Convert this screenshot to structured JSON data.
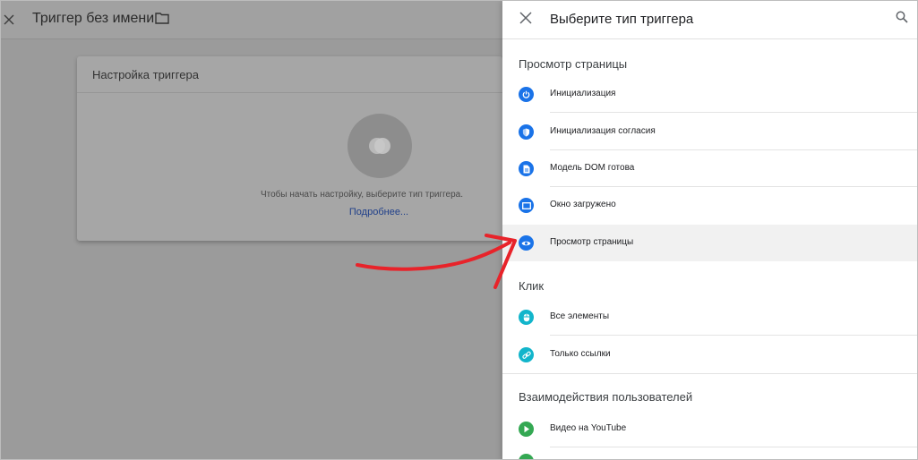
{
  "editor": {
    "title": "Триггер без имени",
    "card": {
      "header": "Настройка триггера",
      "hint": "Чтобы начать настройку, выберите тип триггера.",
      "link": "Подробнее..."
    }
  },
  "panel": {
    "title": "Выберите тип триггера",
    "sections": [
      {
        "title": "Просмотр страницы",
        "items": [
          {
            "label": "Инициализация",
            "icon": "power-icon",
            "color": "#1a73e8"
          },
          {
            "label": "Инициализация согласия",
            "icon": "shield-icon",
            "color": "#1a73e8"
          },
          {
            "label": "Модель DOM готова",
            "icon": "document-icon",
            "color": "#1a73e8"
          },
          {
            "label": "Окно загружено",
            "icon": "window-icon",
            "color": "#1a73e8"
          },
          {
            "label": "Просмотр страницы",
            "icon": "eye-icon",
            "color": "#1a73e8"
          }
        ]
      },
      {
        "title": "Клик",
        "items": [
          {
            "label": "Все элементы",
            "icon": "mouse-icon",
            "color": "#12b5cb"
          },
          {
            "label": "Только ссылки",
            "icon": "link-icon",
            "color": "#12b5cb"
          }
        ]
      },
      {
        "title": "Взаимодействия пользователей",
        "items": [
          {
            "label": "Видео на YouTube",
            "icon": "play-icon",
            "color": "#34a853"
          }
        ]
      }
    ]
  },
  "annotation": {
    "color": "#e8232a",
    "highlighted_item": "Просмотр страницы"
  }
}
